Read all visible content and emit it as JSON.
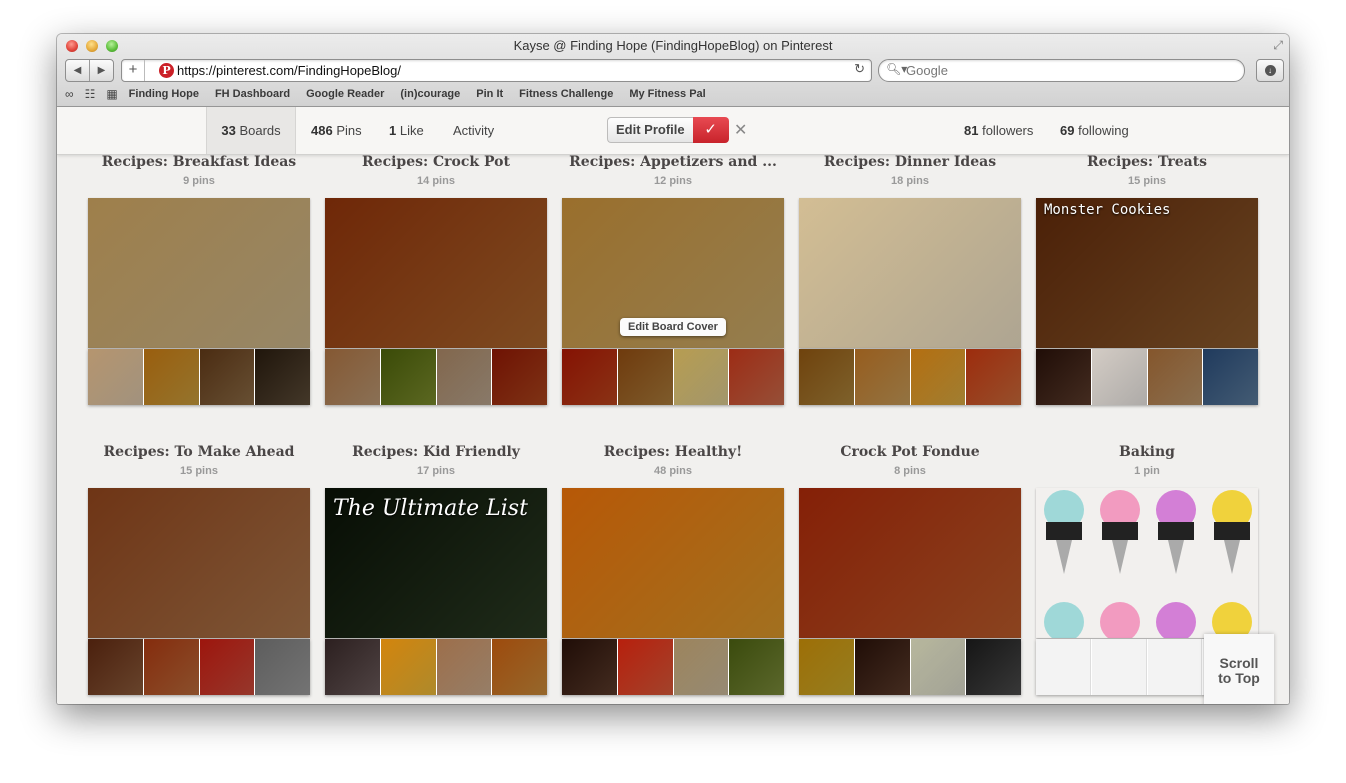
{
  "window": {
    "title": "Kayse @ Finding Hope (FindingHopeBlog) on Pinterest"
  },
  "address_bar": {
    "url": "https://pinterest.com/FindingHopeBlog/",
    "logo_letter": "P"
  },
  "search": {
    "placeholder": "Google"
  },
  "bookmarks": [
    "Finding Hope",
    "FH Dashboard",
    "Google Reader",
    "(in)courage",
    "Pin It",
    "Fitness Challenge",
    "My Fitness Pal"
  ],
  "profile_bar": {
    "boards_count": "33",
    "boards_label": "Boards",
    "pins_count": "486",
    "pins_label": "Pins",
    "likes_count": "1",
    "likes_label": "Like",
    "activity_label": "Activity",
    "edit_profile_label": "Edit Profile",
    "followers_count": "81",
    "followers_label": "followers",
    "following_count": "69",
    "following_label": "following"
  },
  "boards": [
    {
      "title": "Recipes: Breakfast Ideas",
      "count": "9 pins",
      "cover_color": "#c9b48a",
      "thumbs": [
        "#d7c3a8",
        "#c69b3c",
        "#8a6a44",
        "#5a4a36"
      ]
    },
    {
      "title": "Recipes: Crock Pot",
      "count": "14 pins",
      "cover_color": "#a8642c",
      "thumbs": [
        "#b89672",
        "#7a8a2c",
        "#b6a28c",
        "#a8441c"
      ]
    },
    {
      "title": "Recipes: Appetizers and ...",
      "count": "12 pins",
      "cover_color": "#c6a86a",
      "thumbs": [
        "#b8441c",
        "#a87a3a",
        "#d8c890",
        "#c86a4a"
      ],
      "tooltip": "Edit Board Cover"
    },
    {
      "title": "Recipes: Dinner Ideas",
      "count": "18 pins",
      "cover_color": "#e8dcc2",
      "thumbs": [
        "#a8823a",
        "#c49a58",
        "#d6a842",
        "#c86a3a"
      ]
    },
    {
      "title": "Recipes: Treats",
      "count": "15 pins",
      "cover_color": "#8a5a2c",
      "thumbs": [
        "#5a3a2a",
        "#e8e4e0",
        "#b8946a",
        "#5a7a9a"
      ],
      "cover_text": "Monster Cookies"
    },
    {
      "title": "Recipes: To Make Ahead",
      "count": "15 pins",
      "cover_color": "#a8744a",
      "thumbs": [
        "#8a5a3a",
        "#b86a3a",
        "#c84a3a",
        "#9a9a9a"
      ]
    },
    {
      "title": "Recipes: Kid Friendly",
      "count": "17 pins",
      "cover_color": "#2a3a22",
      "thumbs": [
        "#6a5a5a",
        "#e8b83a",
        "#c8a88a",
        "#c88a3a"
      ],
      "cover_text": "The Ultimate List"
    },
    {
      "title": "Recipes: Healthy!",
      "count": "48 pins",
      "cover_color": "#d8962a",
      "thumbs": [
        "#5a3a2a",
        "#d85a3a",
        "#c8b89a",
        "#7a8a3a"
      ]
    },
    {
      "title": "Crock Pot Fondue",
      "count": "8 pins",
      "cover_color": "#b85a2a",
      "thumbs": [
        "#c8a82a",
        "#5a3a2a",
        "#d8d8c8",
        "#4a4a4a"
      ]
    },
    {
      "title": "Baking",
      "count": "1 pin",
      "cover_color": "#f0eeec",
      "thumbs": []
    }
  ],
  "scroll_to_top": {
    "line1": "Scroll",
    "line2": "to Top"
  }
}
